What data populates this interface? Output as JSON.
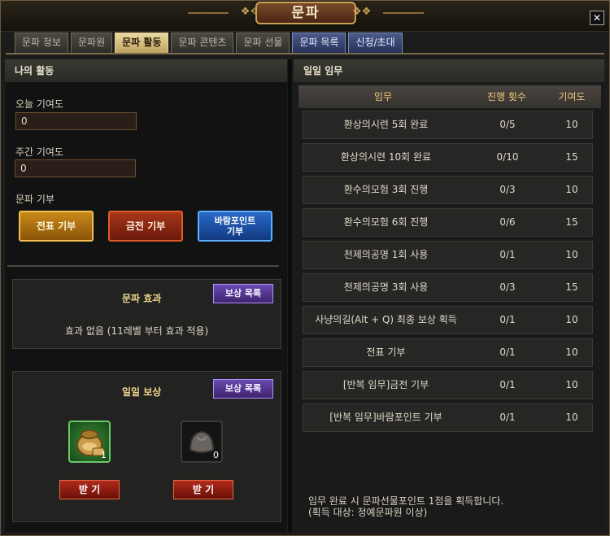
{
  "window": {
    "title": "문파"
  },
  "tabs": [
    {
      "label": "문파 정보"
    },
    {
      "label": "문파원"
    },
    {
      "label": "문파 활동"
    },
    {
      "label": "문파 콘텐츠"
    },
    {
      "label": "문파 선물"
    },
    {
      "label": "문파 목록"
    },
    {
      "label": "신청/초대"
    }
  ],
  "left": {
    "header": "나의 활동",
    "today_label": "오늘 기여도",
    "today_value": "0",
    "weekly_label": "주간 기여도",
    "weekly_value": "0",
    "donate_label": "문파 기부",
    "donate_buttons": {
      "gold": "전표 기부",
      "red": "금전 기부",
      "blue_line1": "바람포인트",
      "blue_line2": "기부"
    },
    "effect": {
      "title": "문파 효과",
      "reward_list": "보상 목록",
      "text": "효과 없음 (11레벨 부터 효과 적용)"
    },
    "daily_reward": {
      "title": "일일 보상",
      "reward_list": "보상 목록",
      "slots": [
        {
          "icon": "pouch-icon",
          "count": "1"
        },
        {
          "icon": "dumpling-icon",
          "count": "0"
        }
      ],
      "receive_label": "받 기"
    }
  },
  "right": {
    "header": "일일 임무",
    "columns": [
      "임무",
      "진행 횟수",
      "기여도"
    ],
    "missions": [
      {
        "name": "환상의시련 5회 완료",
        "progress": "0/5",
        "points": "10"
      },
      {
        "name": "환상의시련 10회 완료",
        "progress": "0/10",
        "points": "15"
      },
      {
        "name": "환수의모험 3회 진행",
        "progress": "0/3",
        "points": "10"
      },
      {
        "name": "환수의모험 6회 진행",
        "progress": "0/6",
        "points": "15"
      },
      {
        "name": "천제의공명 1회 사용",
        "progress": "0/1",
        "points": "10"
      },
      {
        "name": "천제의공명 3회 사용",
        "progress": "0/3",
        "points": "15"
      },
      {
        "name": "사냥의길(Alt + Q) 최종 보상 획득",
        "progress": "0/1",
        "points": "10"
      },
      {
        "name": "전표 기부",
        "progress": "0/1",
        "points": "10"
      },
      {
        "name": "[반복 임무]금전 기부",
        "progress": "0/1",
        "points": "10"
      },
      {
        "name": "[반복 임무]바람포인트 기부",
        "progress": "0/1",
        "points": "10"
      }
    ],
    "note_line1": "임무 완료 시 문파선물포인트 1점을 획득합니다.",
    "note_line2": "(획득 대상: 정예문파원 이상)"
  },
  "colors": {
    "accent_gold": "#c9a25a",
    "active_tab": "#e8d8a0",
    "table_header_text": "#f0c87a"
  }
}
